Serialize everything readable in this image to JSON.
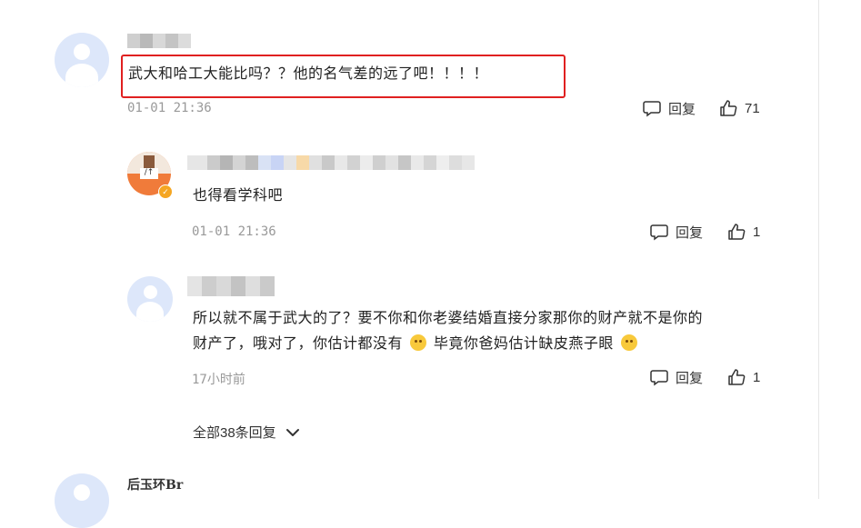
{
  "comments": [
    {
      "text": "武大和哈工大能比吗？？他的名气差的远了吧！！！！",
      "time": "01-01 21:36",
      "reply_label": "回复",
      "like_count": "71"
    }
  ],
  "replies": [
    {
      "text": "也得看学科吧",
      "time": "01-01 21:36",
      "reply_label": "回复",
      "like_count": "1"
    },
    {
      "text_line1": "所以就不属于武大的了？要不你和你老婆结婚直接分家那你的财产就不是你的",
      "text_line2a": "财产了，哦对了，你估计都没有",
      "text_line2b": "毕竟你爸妈估计缺皮燕子眼",
      "time": "17小时前",
      "reply_label": "回复",
      "like_count": "1"
    }
  ],
  "expand_replies": "全部38条回复",
  "next_comment": {
    "name": "后玉环Br"
  },
  "colors": {
    "highlight": "#e02020",
    "verified_badge": "#f5a623",
    "avatar_placeholder": "#dde7fa"
  }
}
